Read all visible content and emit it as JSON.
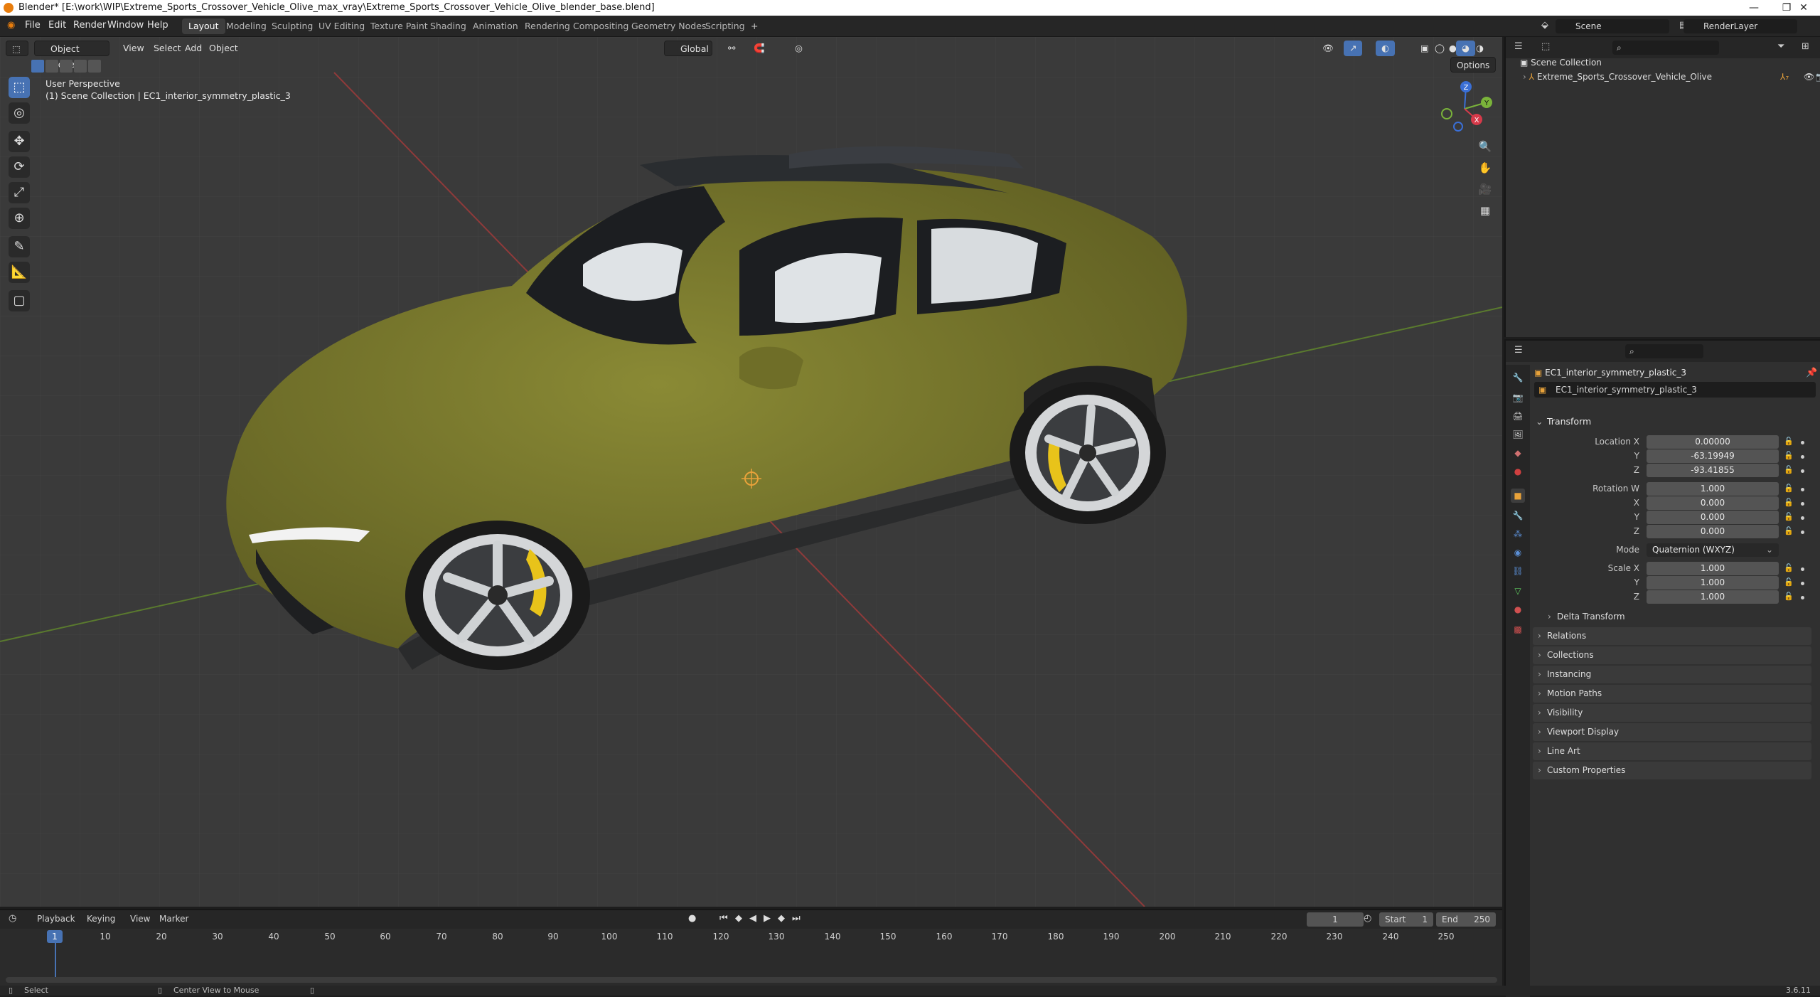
{
  "window": {
    "title": "Blender* [E:\\work\\WIP\\Extreme_Sports_Crossover_Vehicle_Olive_max_vray\\Extreme_Sports_Crossover_Vehicle_Olive_blender_base.blend]",
    "min_glyph": "—",
    "max_glyph": "❐",
    "close_glyph": "✕"
  },
  "menu": [
    "File",
    "Edit",
    "Render",
    "Window",
    "Help"
  ],
  "workspaces": [
    "Layout",
    "Modeling",
    "Sculpting",
    "UV Editing",
    "Texture Paint",
    "Shading",
    "Animation",
    "Rendering",
    "Compositing",
    "Geometry Nodes",
    "Scripting"
  ],
  "add_workspace": "+",
  "scene": {
    "name": "Scene",
    "view_layer": "RenderLayer"
  },
  "viewport": {
    "mode": "Object Mode",
    "menus": [
      "View",
      "Select",
      "Add",
      "Object"
    ],
    "orientation": "Global",
    "options": "Options",
    "info_line1": "User Perspective",
    "info_line2": "(1) Scene Collection | EC1_interior_symmetry_plastic_3",
    "gizmo": {
      "z": "Z",
      "y": "Y",
      "x": "X"
    }
  },
  "outliner": {
    "root": "Scene Collection",
    "items": [
      {
        "name": "Extreme_Sports_Crossover_Vehicle_Olive"
      }
    ]
  },
  "properties": {
    "object_name": "EC1_interior_symmetry_plastic_3",
    "data_name": "EC1_interior_symmetry_plastic_3",
    "transform_header": "Transform",
    "location": {
      "label": "Location X",
      "x": "0.00000",
      "y": "-63.19949",
      "z": "-93.41855"
    },
    "rotation": {
      "label": "Rotation W",
      "w": "1.000",
      "x": "0.000",
      "y": "0.000",
      "z": "0.000"
    },
    "mode": {
      "label": "Mode",
      "value": "Quaternion (WXYZ)"
    },
    "scale": {
      "label": "Scale X",
      "x": "1.000",
      "y": "1.000",
      "z": "1.000"
    },
    "axis_y": "Y",
    "axis_z": "Z",
    "axis_x": "X",
    "delta": "Delta Transform",
    "panels": [
      "Relations",
      "Collections",
      "Instancing",
      "Motion Paths",
      "Visibility",
      "Viewport Display",
      "Line Art",
      "Custom Properties"
    ]
  },
  "timeline": {
    "menus": [
      "Playback",
      "Keying",
      "View",
      "Marker"
    ],
    "current_frame": "1",
    "start_label": "Start",
    "start": "1",
    "end_label": "End",
    "end": "250",
    "ticks": [
      "10",
      "20",
      "30",
      "40",
      "50",
      "60",
      "70",
      "80",
      "90",
      "100",
      "110",
      "120",
      "130",
      "140",
      "150",
      "160",
      "170",
      "180",
      "190",
      "200",
      "210",
      "220",
      "230",
      "240",
      "250"
    ],
    "playhead": "1"
  },
  "status": {
    "left": "Select",
    "middle": "Center View to Mouse",
    "version": "3.6.11"
  },
  "colors": {
    "car_body": "#7b7a2d",
    "accent": "#4772b3",
    "caliper": "#e8c31a"
  }
}
